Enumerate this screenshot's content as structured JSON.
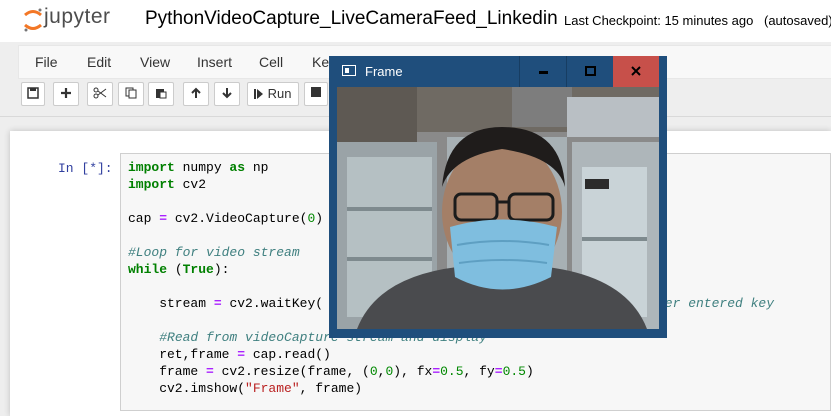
{
  "header": {
    "logo_text": "jupyter",
    "notebook_title": "PythonVideoCapture_LiveCameraFeed_Linkedin",
    "checkpoint": "Last Checkpoint: 15 minutes ago",
    "autosave": "(autosaved)"
  },
  "menu": [
    "File",
    "Edit",
    "View",
    "Insert",
    "Cell",
    "Ke"
  ],
  "toolbar": {
    "run_label": "Run"
  },
  "cell": {
    "prompt": "In [*]:",
    "code_comment_tail": "ser entered key"
  },
  "window": {
    "title": "Frame",
    "accent": "#1f4e7c",
    "close_color": "#c7504a"
  },
  "colors": {
    "prompt": "#303f9f",
    "keyword": "#008000",
    "comment": "#408080",
    "string": "#ba2121"
  },
  "icons": [
    "save-icon",
    "plus-icon",
    "scissors-icon",
    "copy-icon",
    "paste-icon",
    "arrow-up-icon",
    "arrow-down-icon",
    "step-icon",
    "stop-icon"
  ]
}
